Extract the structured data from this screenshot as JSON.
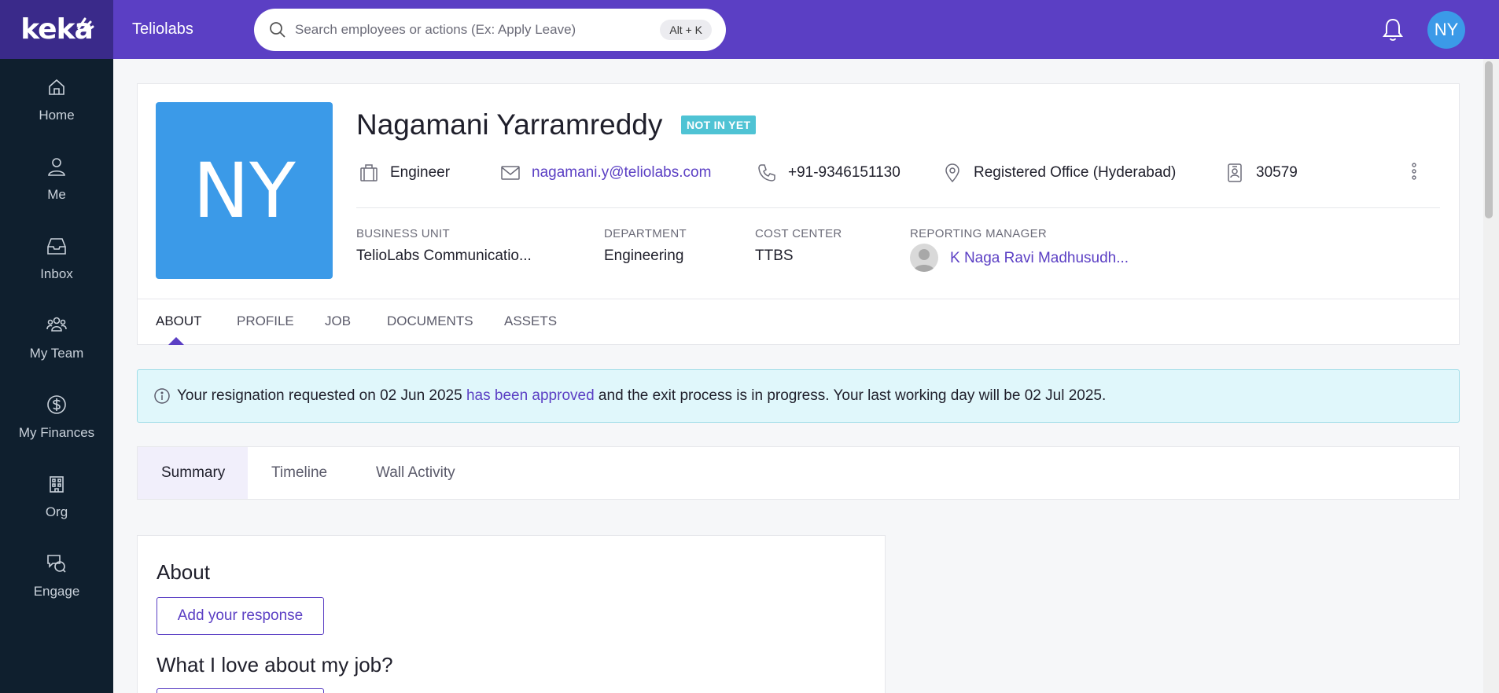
{
  "brand": {
    "logo": "keka",
    "org_name": "Teliolabs"
  },
  "search": {
    "placeholder": "Search employees or actions (Ex: Apply Leave)",
    "shortcut": "Alt + K"
  },
  "user": {
    "initials": "NY"
  },
  "sidebar": {
    "items": [
      {
        "label": "Home",
        "icon": "home-icon"
      },
      {
        "label": "Me",
        "icon": "person-icon"
      },
      {
        "label": "Inbox",
        "icon": "inbox-icon"
      },
      {
        "label": "My Team",
        "icon": "team-icon"
      },
      {
        "label": "My Finances",
        "icon": "dollar-icon"
      },
      {
        "label": "Org",
        "icon": "building-icon"
      },
      {
        "label": "Engage",
        "icon": "chat-icon"
      }
    ]
  },
  "profile": {
    "initials": "NY",
    "name": "Nagamani Yarramreddy",
    "status": "NOT IN YET",
    "designation": "Engineer",
    "email": "nagamani.y@teliolabs.com",
    "phone": "+91-9346151130",
    "location": "Registered Office (Hyderabad)",
    "employee_id": "30579",
    "business_unit_label": "BUSINESS UNIT",
    "business_unit": "TelioLabs Communicatio...",
    "department_label": "DEPARTMENT",
    "department": "Engineering",
    "cost_center_label": "COST CENTER",
    "cost_center": "TTBS",
    "manager_label": "REPORTING MANAGER",
    "manager": "K Naga Ravi Madhusudh..."
  },
  "tabs": [
    {
      "label": "ABOUT",
      "active": true
    },
    {
      "label": "PROFILE"
    },
    {
      "label": "JOB"
    },
    {
      "label": "DOCUMENTS"
    },
    {
      "label": "ASSETS"
    }
  ],
  "alert": {
    "text_before": "Your resignation requested on 02 Jun 2025 ",
    "link": "has been approved",
    "text_after": " and the exit process is in progress. Your last working day will be 02 Jul 2025."
  },
  "subtabs": [
    {
      "label": "Summary",
      "active": true
    },
    {
      "label": "Timeline"
    },
    {
      "label": "Wall Activity"
    }
  ],
  "about": {
    "title": "About",
    "response_button": "Add your response",
    "love_title": "What I love about my job?"
  },
  "colors": {
    "brand": "#5b3fc4",
    "sidebar": "#0f1f2e",
    "avatar": "#3b9ae8",
    "badge": "#4fc3d4"
  }
}
